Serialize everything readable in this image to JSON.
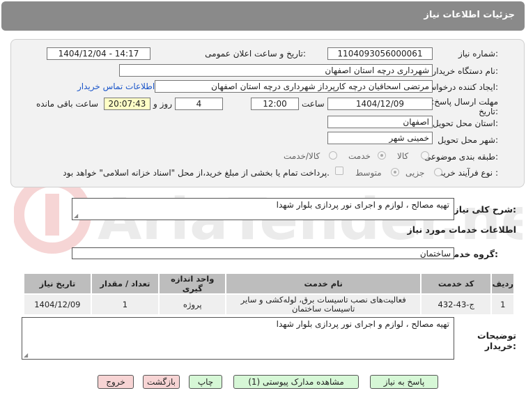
{
  "header": {
    "title": "جزئیات اطلاعات نیاز"
  },
  "form": {
    "need_number_label": "شماره نیاز:",
    "need_number": "1104093056000061",
    "announce_label": "تاریخ و ساعت اعلان عمومی:",
    "announce_value": "1404/12/04 - 14:17",
    "buyer_org_label": "نام دستگاه خریدار:",
    "buyer_org": "شهرداری درچه استان اصفهان",
    "creator_label": "ایجاد کننده درخواست:",
    "creator": "مرتضی اسحاقیان درچه کارپرداز شهرداری درچه استان اصفهان",
    "contact_link": "اطلاعات تماس خریدار",
    "deadline_label_1": "مهلت ارسال پاسخ: تا",
    "deadline_label_2": "تاریخ:",
    "deadline_date": "1404/12/09",
    "time_label": "ساعت",
    "deadline_time": "12:00",
    "days_value": "4",
    "days_label": "روز و",
    "remaining_time": "20:07:43",
    "remaining_label": "ساعت باقی مانده",
    "province_label": "استان محل تحویل:",
    "province": "اصفهان",
    "city_label": "شهر محل تحویل:",
    "city": "خمینی شهر",
    "category_label": "طبقه بندی موضوعی:",
    "category_options": [
      "کالا",
      "خدمت",
      "کالا/خدمت"
    ],
    "category_selected": "خدمت",
    "process_label": "نوع فرآیند خرید :",
    "process_options": [
      "جزیی",
      "متوسط"
    ],
    "process_selected": "متوسط",
    "payment_note": "پرداخت تمام یا بخشی از مبلغ خرید،از محل \"اسناد خزانه اسلامی\" خواهد بود."
  },
  "summary": {
    "label": "شرح کلی نیاز:",
    "text": "تهیه مصالح ، لوازم  و اجرای نور پردازی بلوار شهدا"
  },
  "services": {
    "title": "اطلاعات خدمات مورد نیاز",
    "group_label": "گروه خدمت:",
    "group_value": "ساختمان",
    "columns": [
      "ردیف",
      "کد خدمت",
      "نام خدمت",
      "واحد اندازه گیری",
      "تعداد / مقدار",
      "تاریخ نیاز"
    ],
    "rows": [
      [
        "1",
        "ج-43-432",
        "فعالیت‌های نصب تاسیسات برق، لوله‌کشی و سایر تاسیسات ساختمان",
        "پروژه",
        "1",
        "1404/12/09"
      ]
    ]
  },
  "buyer_notes": {
    "label_1": "توضیحات",
    "label_2": "خریدار:",
    "text": "تهیه مصالح ، لوازم  و اجرای نور پردازی بلوار شهدا"
  },
  "buttons": {
    "reply": "پاسخ به نیاز",
    "attachments": "مشاهده مدارک پیوستی (1)",
    "print": "چاپ",
    "back": "بازگشت",
    "exit": "خروج"
  },
  "watermark": {
    "text": "AriaTender.net"
  },
  "colors": {
    "title_bg": "#8a8a8a",
    "panel_bg": "#f2f2f2",
    "link": "#1a55c9",
    "highlight": "#ffffc6",
    "btn_green": "#d6f7d6",
    "btn_pink": "#f7d4d4"
  }
}
